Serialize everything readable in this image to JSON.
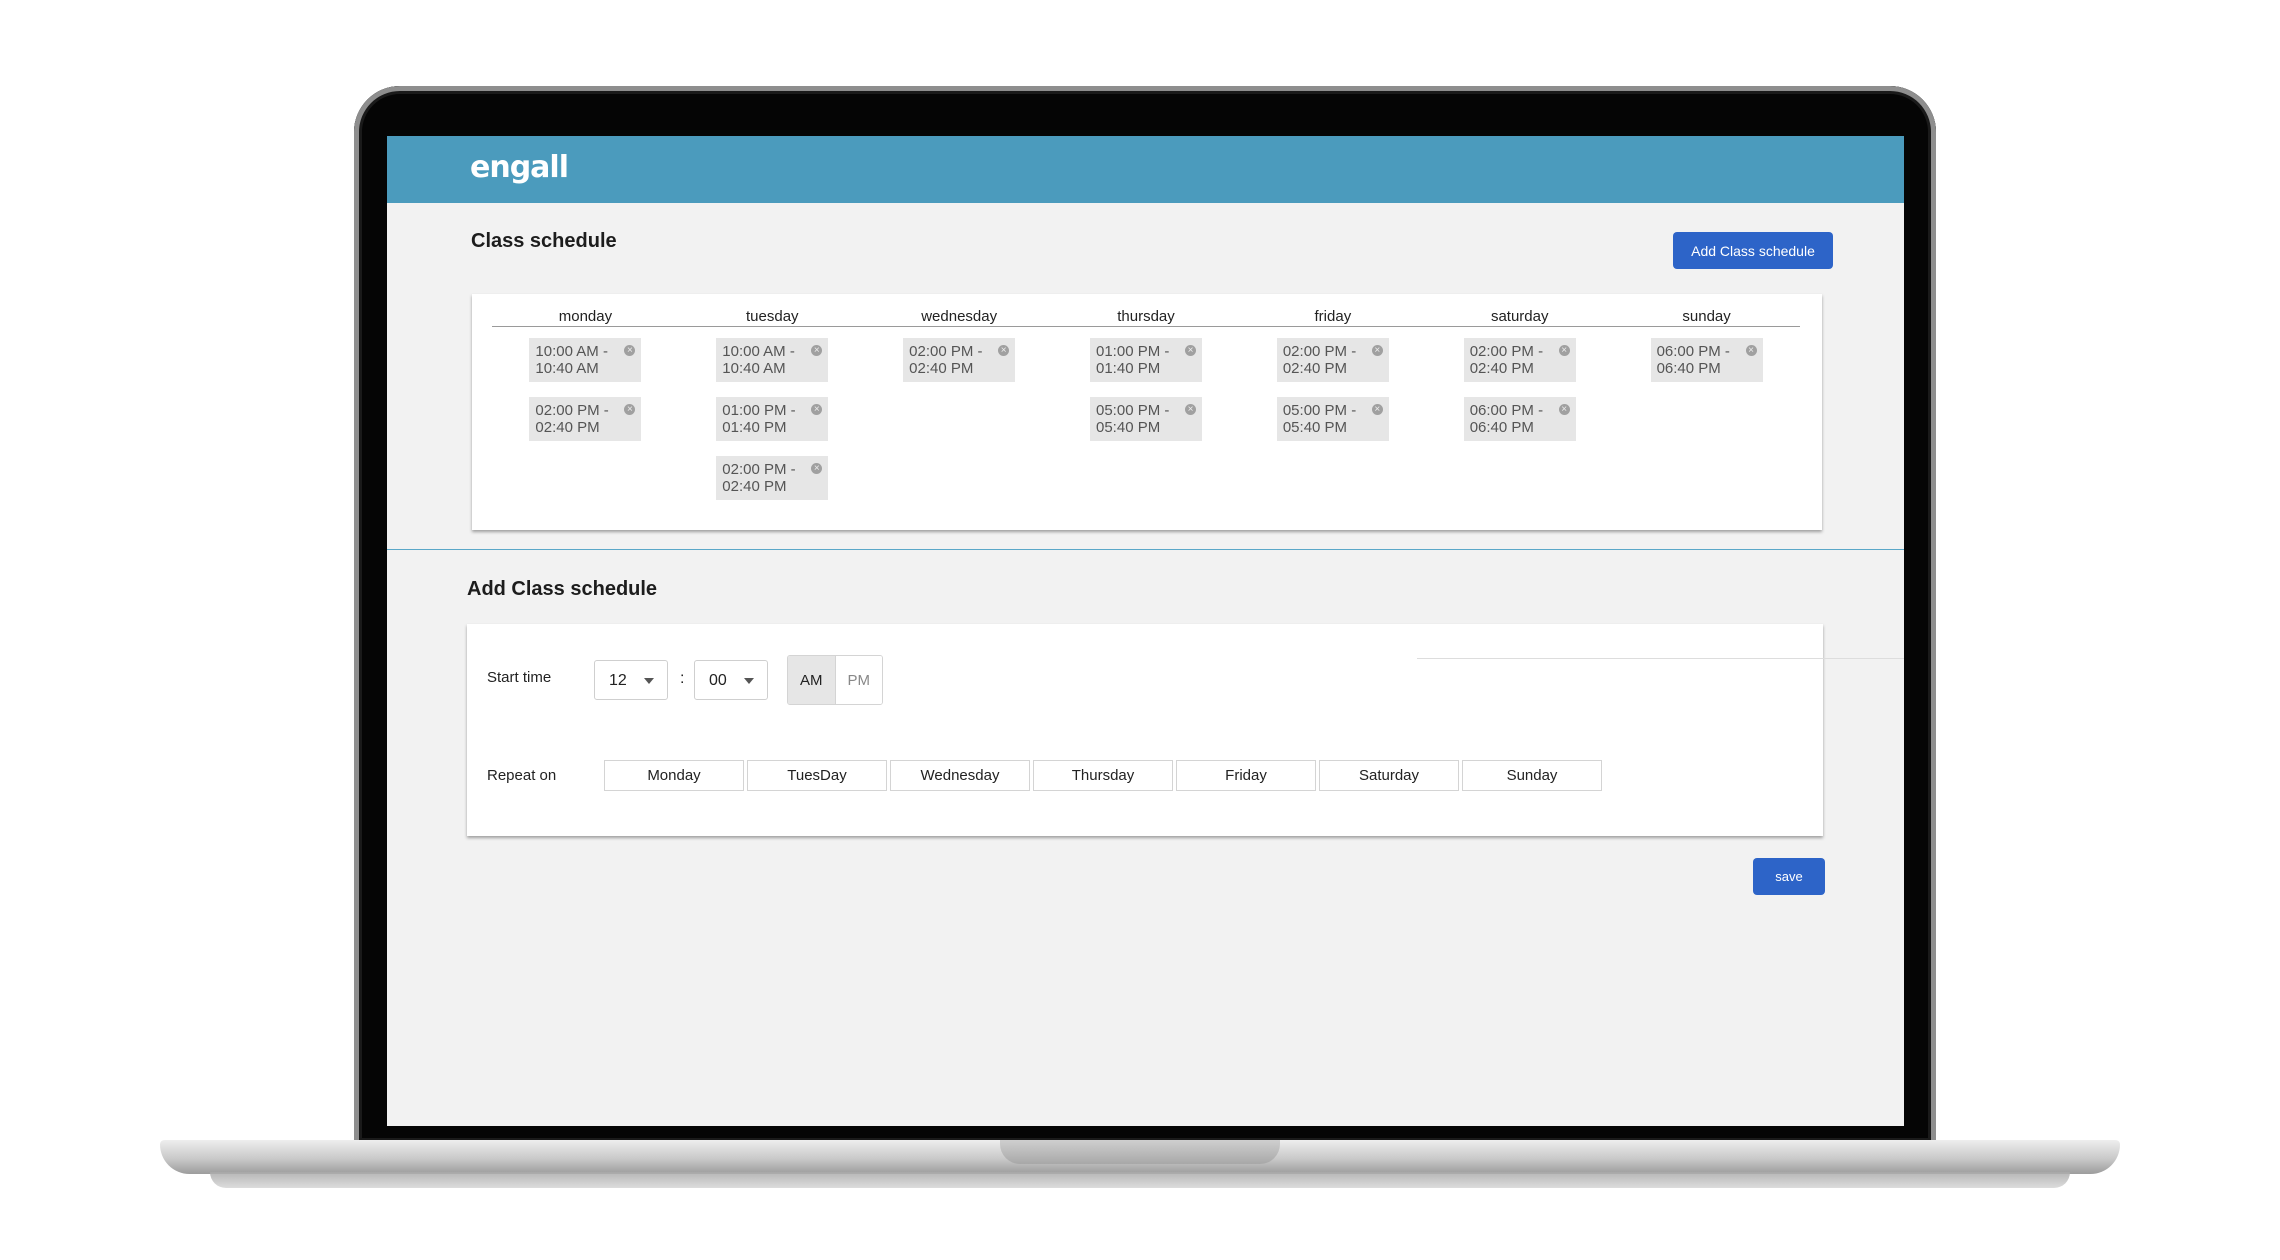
{
  "brand": {
    "logo_text": "engall"
  },
  "schedule": {
    "title": "Class schedule",
    "add_button": "Add Class schedule",
    "days": [
      "monday",
      "tuesday",
      "wednesday",
      "thursday",
      "friday",
      "saturday",
      "sunday"
    ],
    "slots": {
      "monday": [
        {
          "start": "10:00 AM -",
          "end": "10:40 AM"
        },
        {
          "start": "02:00 PM -",
          "end": "02:40 PM"
        }
      ],
      "tuesday": [
        {
          "start": "10:00 AM -",
          "end": "10:40 AM"
        },
        {
          "start": "01:00 PM -",
          "end": "01:40 PM"
        },
        {
          "start": "02:00 PM -",
          "end": "02:40 PM"
        }
      ],
      "wednesday": [
        {
          "start": "02:00 PM -",
          "end": "02:40 PM"
        }
      ],
      "thursday": [
        {
          "start": "01:00 PM -",
          "end": "01:40 PM"
        },
        {
          "start": "05:00 PM -",
          "end": "05:40 PM"
        }
      ],
      "friday": [
        {
          "start": "02:00 PM -",
          "end": "02:40 PM"
        },
        {
          "start": "05:00 PM -",
          "end": "05:40 PM"
        }
      ],
      "saturday": [
        {
          "start": "02:00 PM -",
          "end": "02:40 PM"
        },
        {
          "start": "06:00 PM -",
          "end": "06:40 PM"
        }
      ],
      "sunday": [
        {
          "start": "06:00 PM -",
          "end": "06:40 PM"
        }
      ]
    }
  },
  "add_form": {
    "title": "Add Class schedule",
    "start_time_label": "Start time",
    "hour": "12",
    "minute": "00",
    "separator": ":",
    "am_label": "AM",
    "pm_label": "PM",
    "selected_period": "AM",
    "repeat_label": "Repeat on",
    "repeat_days": [
      "Monday",
      "TuesDay",
      "Wednesday",
      "Thursday",
      "Friday",
      "Saturday",
      "Sunday"
    ],
    "save_button": "save"
  },
  "colors": {
    "header_bar": "#4b9bbd",
    "primary_button": "#2d64c8",
    "background": "#f2f2f2",
    "slot_background": "#e6e6e6"
  }
}
